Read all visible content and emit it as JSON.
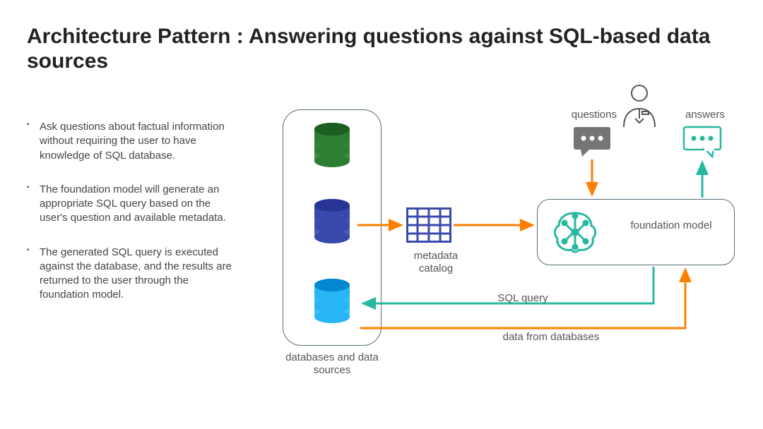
{
  "title": "Architecture Pattern : Answering questions against SQL-based data sources",
  "bullets": [
    "Ask questions about factual information without requiring the user to have knowledge of SQL  database.",
    "The foundation model will generate an appropriate SQL query based on the user's question and available metadata.",
    "The generated SQL query is executed against the database, and the results are returned to the user through the foundation model."
  ],
  "labels": {
    "databases": "databases and data sources",
    "metadata": "metadata catalog",
    "foundation_model": "foundation model",
    "questions": "questions",
    "answers": "answers",
    "sql_query": "SQL query",
    "data_from_db": "data from databases"
  },
  "colors": {
    "orange": "#ff7f00",
    "teal": "#27b8a0",
    "green_db": "#2e7d32",
    "blue_db": "#3949ab",
    "cyan_db": "#29b6f6",
    "grid_blue": "#3949ab",
    "grey": "#757575"
  }
}
